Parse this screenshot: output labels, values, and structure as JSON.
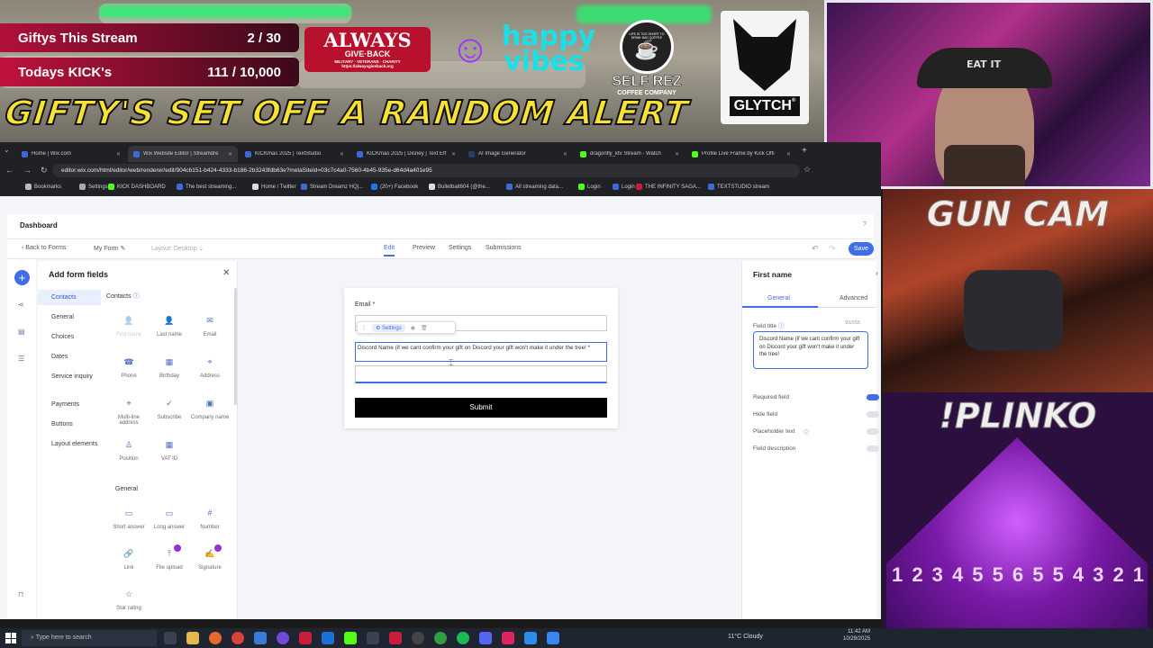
{
  "overlay": {
    "stat1": {
      "label": "Giftys This Stream",
      "value": "2 / 30"
    },
    "stat2": {
      "label": "Todays KICK's",
      "value": "111 / 10,000"
    },
    "alert_banner": "GIFTY'S SET OFF A RANDOM ALERT",
    "sponsors": {
      "always": "ALWAYS",
      "give_back": "GIVE·BACK",
      "always_tag": "MILITARY · VETERANS · CHARITY",
      "always_url": "https://alwaysgiveback.org",
      "happy": "happy",
      "vibes": "vibes",
      "happy_tm": "™",
      "selfrez": "SELF REZ",
      "selfrez_sub": "COFFEE COMPANY",
      "selfrez_ring": "LIFE IS TOO SHORT TO DRINK BAD COFFEE",
      "glytch": "GLYTCH",
      "glytch_mark": "®"
    },
    "cams": {
      "gun_cam": "GUN CAM",
      "plinko": "!PLINKO",
      "hat_text": "EAT IT",
      "plinko_slots": [
        "1",
        "2",
        "3",
        "4",
        "5",
        "5",
        "6",
        "5",
        "5",
        "4",
        "3",
        "2",
        "1"
      ]
    }
  },
  "browser": {
    "tabs": [
      {
        "label": "Home | Wix.com",
        "color": "#3d6bd6"
      },
      {
        "label": "Wix Website Editor | Streamdre",
        "color": "#3d6bd6"
      },
      {
        "label": "KICKmas 2025 | TextStudio",
        "color": "#3d6bd6"
      },
      {
        "label": "KICKmas 2025 | Disney | Text Eff",
        "color": "#3d6bd6"
      },
      {
        "label": "AI Image Generator",
        "color": "#1e3f72"
      },
      {
        "label": "dragonfly_ktv Stream - Watch",
        "color": "#53fc18"
      },
      {
        "label": "Profile Live Frame by Kick Offi",
        "color": "#53fc18"
      }
    ],
    "url": "editor.wix.com/html/editor/web/renderer/edit/904cb151-b424-4333-b186-2b3243fdb63e?metaSiteId=03c7c4a0-7560-4b45-935e-d64d4a401e95",
    "bookmarks": [
      "Bookmarks",
      "Settings",
      "KICK DASHBOARD",
      "The best streaming...",
      "Home / Twitter",
      "Stream Dreamz HQ|...",
      "(20+) Facebook",
      "Bulletbait604 (@the...",
      "All streaming data...",
      "Login",
      "Login",
      "THE INFINITY SAGA...",
      "TEXTSTUDIO stream"
    ]
  },
  "wix": {
    "dashboard": "Dashboard",
    "help": "?",
    "back": "Back to Forms",
    "form_name": "My Form",
    "layout": "Layout: Desktop",
    "nav": [
      "Edit",
      "Preview",
      "Settings",
      "Submissions"
    ],
    "save": "Save",
    "add_panel": {
      "title": "Add form fields",
      "categories": [
        "Contacts",
        "General",
        "Choices",
        "Dates",
        "Service inquiry",
        "Payments",
        "Buttons",
        "Layout elements"
      ],
      "contacts_header": "Contacts",
      "contact_fields": [
        "First name",
        "Last name",
        "Email",
        "Phone",
        "Birthday",
        "Address",
        "Multi-line address",
        "Subscribe",
        "Company name",
        "Position",
        "VAT ID"
      ],
      "general_header": "General",
      "general_fields": [
        "Short answer",
        "Long answer",
        "Number",
        "Link",
        "File upload",
        "Signature",
        "Star rating"
      ]
    },
    "canvas": {
      "email_label": "Email *",
      "toolbar_settings": "Settings",
      "discord_label": "Discord Name (if we cant confirm your gift on Discord your gift won't make it under the tree! *",
      "submit": "Submit"
    },
    "right_panel": {
      "title": "First name",
      "tabs": [
        "General",
        "Advanced"
      ],
      "field_title_label": "Field title",
      "char_count": "93/255",
      "field_title_value": "Discord Name (if we cant confirm your gift on Discord your gift won't make it under the tree!",
      "options": [
        "Required field",
        "Hide field",
        "Placeholder text",
        "Field description"
      ]
    }
  },
  "taskbar": {
    "search_placeholder": "Type here to search",
    "weather": "11°C  Cloudy",
    "time": "11:42 AM",
    "date": "10/29/2025"
  }
}
